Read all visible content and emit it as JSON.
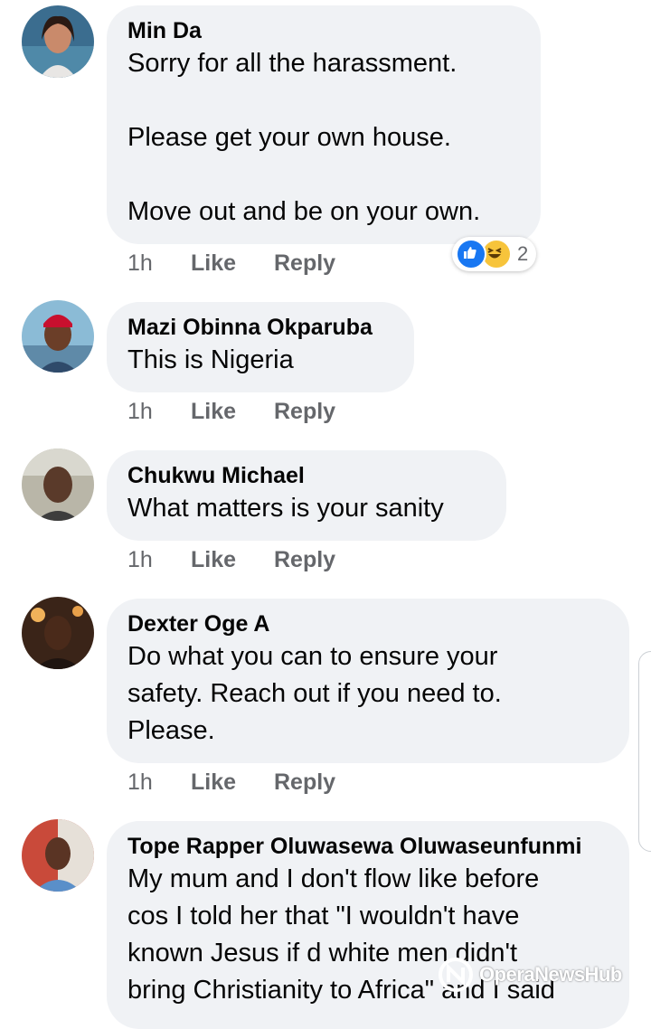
{
  "comments": [
    {
      "author": "Min Da",
      "text": "Sorry for all the harassment.\n\nPlease get your own house.\n\nMove out and be on your own.",
      "time": "1h",
      "like": "Like",
      "reply": "Reply",
      "reactions": {
        "count": "2",
        "icons": [
          "like-icon",
          "haha-icon"
        ]
      }
    },
    {
      "author": "Mazi Obinna Okparuba",
      "text": "This is Nigeria",
      "time": "1h",
      "like": "Like",
      "reply": "Reply"
    },
    {
      "author": "Chukwu Michael",
      "text": "What matters is your sanity",
      "time": "1h",
      "like": "Like",
      "reply": "Reply"
    },
    {
      "author": "Dexter Oge A",
      "text": "Do what you can to ensure your\nsafety. Reach out if you need to.\nPlease.",
      "time": "1h",
      "like": "Like",
      "reply": "Reply"
    },
    {
      "author": "Tope Rapper Oluwasewa Oluwaseunfunmi",
      "text": "My mum and I don't flow like before\ncos I told her that \"I wouldn't have\nknown Jesus if d white men didn't\nbring Christianity to Africa\" and I said"
    }
  ],
  "watermark": {
    "text": "OperaNewsHub"
  },
  "colors": {
    "bubble": "#f0f2f5",
    "meta": "#65676b",
    "like_blue": "#1877f2",
    "haha_yellow": "#f7c43b"
  }
}
